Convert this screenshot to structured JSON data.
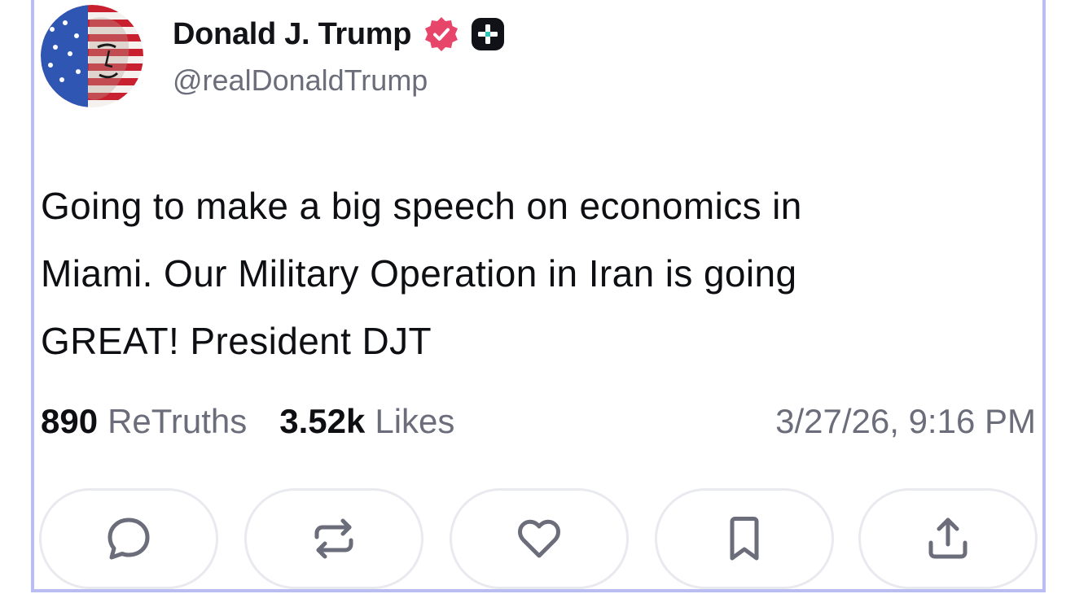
{
  "post": {
    "author": {
      "display_name": "Donald J. Trump",
      "handle": "@realDonaldTrump",
      "avatar_icon": "flag-portrait-avatar",
      "badges": [
        "verified-badge-icon",
        "plus-badge-icon"
      ]
    },
    "text_lines": [
      "Going to make a big speech on economics in",
      "Miami. Our Military Operation in Iran is going",
      "GREAT! President DJT"
    ],
    "stats": {
      "retruths_count": "890",
      "retruths_label": "ReTruths",
      "likes_count": "3.52k",
      "likes_label": "Likes"
    },
    "timestamp": "3/27/26, 9:16 PM",
    "actions": [
      {
        "name": "reply",
        "icon": "comment-icon"
      },
      {
        "name": "retruth",
        "icon": "repost-icon"
      },
      {
        "name": "like",
        "icon": "heart-icon"
      },
      {
        "name": "bookmark",
        "icon": "bookmark-icon"
      },
      {
        "name": "share",
        "icon": "share-icon"
      }
    ]
  },
  "colors": {
    "frame_border": "#b9bdf2",
    "verified_badge": "#e8456b",
    "text_primary": "#0e0f13",
    "text_secondary": "#6b6e7a",
    "icon_gray": "#6b6e7a",
    "button_border": "#e9eaef"
  }
}
